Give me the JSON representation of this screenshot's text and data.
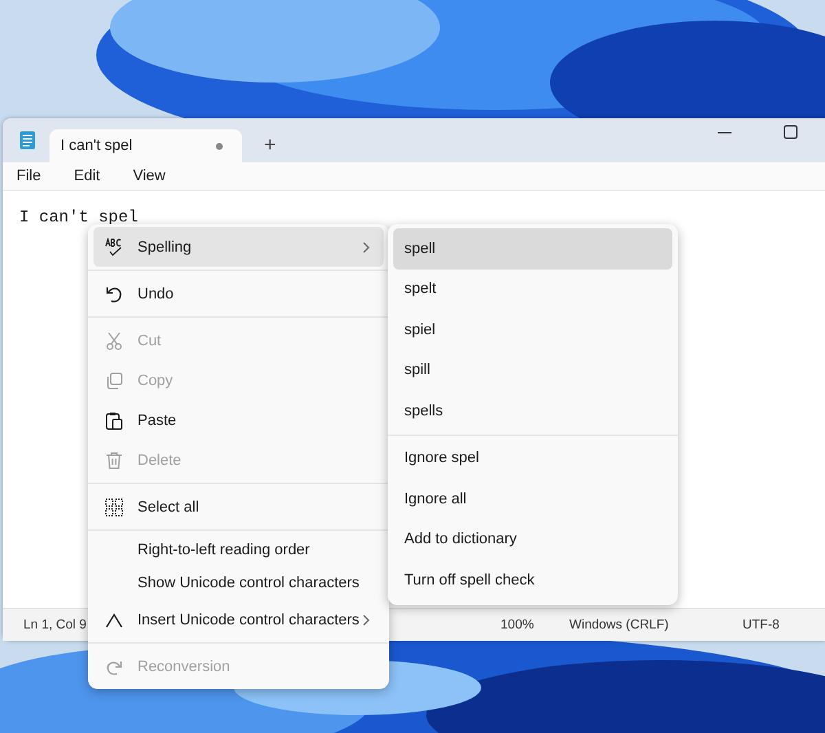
{
  "wallpaper": {
    "kind": "picture"
  },
  "window": {
    "tab": {
      "title": "I can't spel",
      "modified": true,
      "selected": true
    },
    "new_tab": "+"
  },
  "menu_bar": [
    "File",
    "Edit",
    "View"
  ],
  "editor": {
    "text": [
      {
        "text": "I can't ",
        "misspelled": false
      },
      {
        "text": "spel",
        "misspelled": true
      }
    ]
  },
  "status_bar": [
    "Ln 1, Col 9",
    "100%",
    "Windows (CRLF)",
    "UTF-8"
  ],
  "context_menu": {
    "groups": [
      [
        {
          "label": "Spelling",
          "submenu": true,
          "selected": true,
          "disabled": false
        }
      ],
      [
        {
          "label": "Undo",
          "submenu": false,
          "selected": false,
          "disabled": false
        }
      ],
      [
        {
          "label": "Cut",
          "submenu": false,
          "selected": false,
          "disabled": true
        },
        {
          "label": "Copy",
          "submenu": false,
          "selected": false,
          "disabled": true
        },
        {
          "label": "Paste",
          "submenu": false,
          "selected": false,
          "disabled": false
        },
        {
          "label": "Delete",
          "submenu": false,
          "selected": false,
          "disabled": true
        }
      ],
      [
        {
          "label": "Select all",
          "submenu": false,
          "selected": false,
          "disabled": false
        }
      ],
      [
        {
          "label": "Right-to-left reading order",
          "submenu": false,
          "selected": false,
          "disabled": false
        },
        {
          "label": "Show Unicode control characters",
          "submenu": false,
          "selected": false,
          "disabled": false
        },
        {
          "label": "Insert Unicode control characters",
          "submenu": true,
          "selected": false,
          "disabled": false
        }
      ],
      [
        {
          "label": "Reconversion",
          "submenu": false,
          "selected": false,
          "disabled": true
        }
      ]
    ]
  },
  "spelling_submenu": {
    "groups": [
      [
        {
          "label": "spell",
          "selected": true
        },
        {
          "label": "spelt",
          "selected": false
        },
        {
          "label": "spiel",
          "selected": false
        },
        {
          "label": "spill",
          "selected": false
        },
        {
          "label": "spells",
          "selected": false
        }
      ],
      [
        {
          "label": "Ignore spel",
          "selected": false
        },
        {
          "label": "Ignore all",
          "selected": false
        },
        {
          "label": "Add to dictionary",
          "selected": false
        },
        {
          "label": "Turn off spell check",
          "selected": false
        }
      ]
    ]
  }
}
